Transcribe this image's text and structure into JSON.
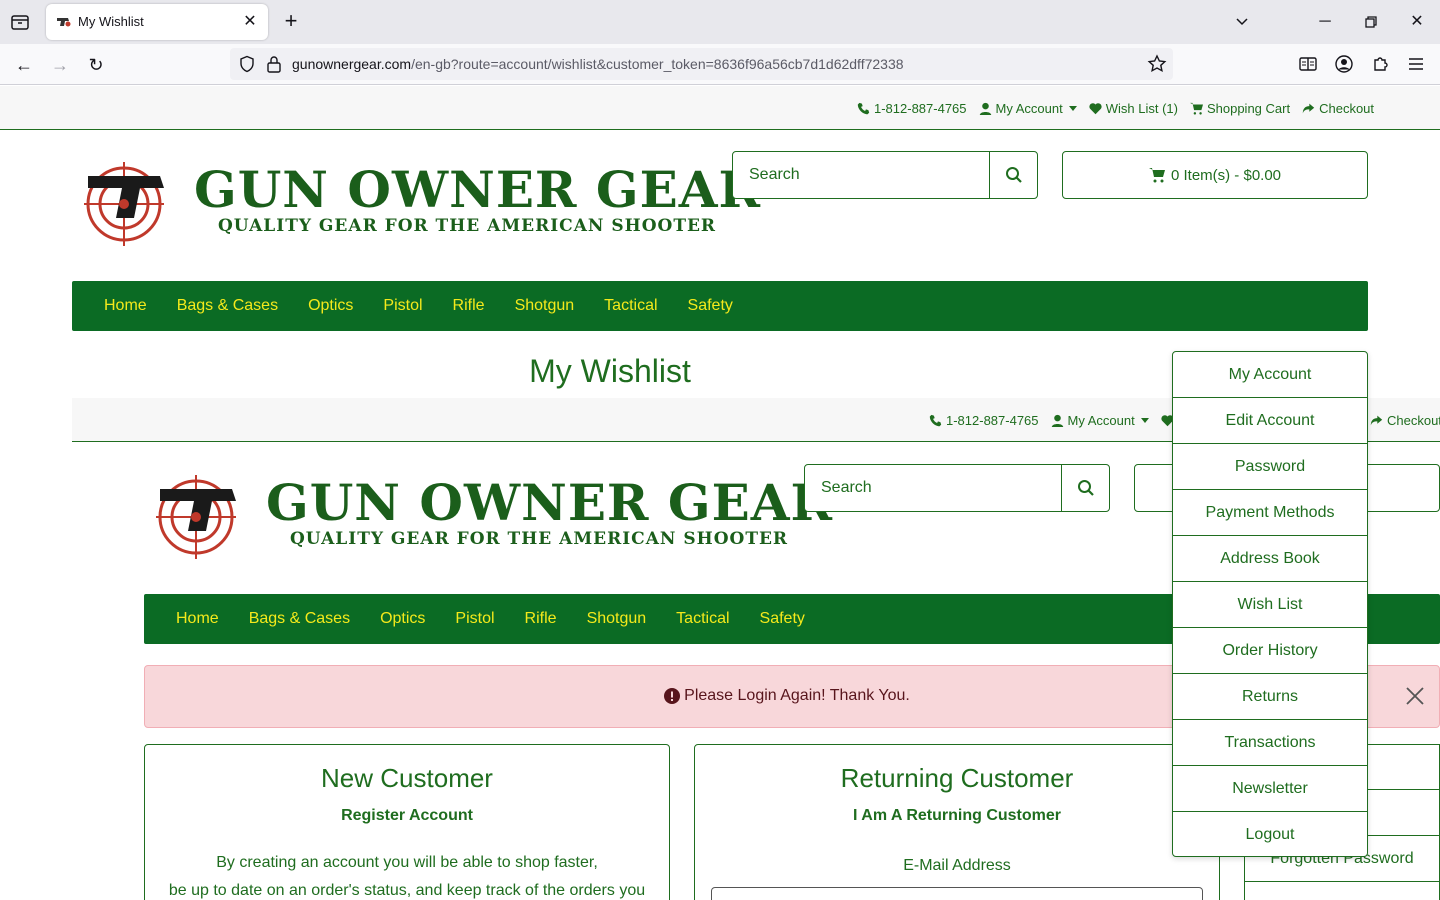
{
  "browser": {
    "tab_title": "My Wishlist",
    "url_host": "gunownergear.com",
    "url_path": "/en-gb?route=account/wishlist&customer_token=8636f96a56cb7d1d62dff72338"
  },
  "header": {
    "phone": "1-812-887-4765",
    "my_account": "My Account",
    "wish_list": "Wish List (1)",
    "shopping_cart": "Shopping Cart",
    "checkout": "Checkout",
    "logo_title": "GUN OWNER GEAR",
    "logo_tagline": "QUALITY GEAR FOR THE AMERICAN SHOOTER",
    "logo_badge": "GUN OWNER GEAR",
    "search_placeholder": "Search",
    "cart_summary": "0 Item(s) - $0.00"
  },
  "menu": [
    "Home",
    "Bags & Cases",
    "Optics",
    "Pistol",
    "Rifle",
    "Shotgun",
    "Tactical",
    "Safety"
  ],
  "page_title": "My Wishlist",
  "alert": {
    "message": "Please Login Again! Thank You."
  },
  "new_customer": {
    "title": "New Customer",
    "subtitle": "Register Account",
    "line1": "By creating an account you will be able to shop faster,",
    "line2": "be up to date on an order's status, and keep track of the orders you"
  },
  "returning_customer": {
    "title": "Returning Customer",
    "subtitle": "I Am A Returning Customer",
    "email_label": "E-Mail Address"
  },
  "account_column": {
    "forgotten": "Forgotten Password"
  },
  "dropdown": [
    "My Account",
    "Edit Account",
    "Password",
    "Payment Methods",
    "Address Book",
    "Wish List",
    "Order History",
    "Returns",
    "Transactions",
    "Newsletter",
    "Logout"
  ],
  "colors": {
    "brand_green": "#0b6b24",
    "text_green": "#1f6d1f",
    "menu_text": "#f4e91b",
    "alert_bg": "#f8d7da"
  }
}
